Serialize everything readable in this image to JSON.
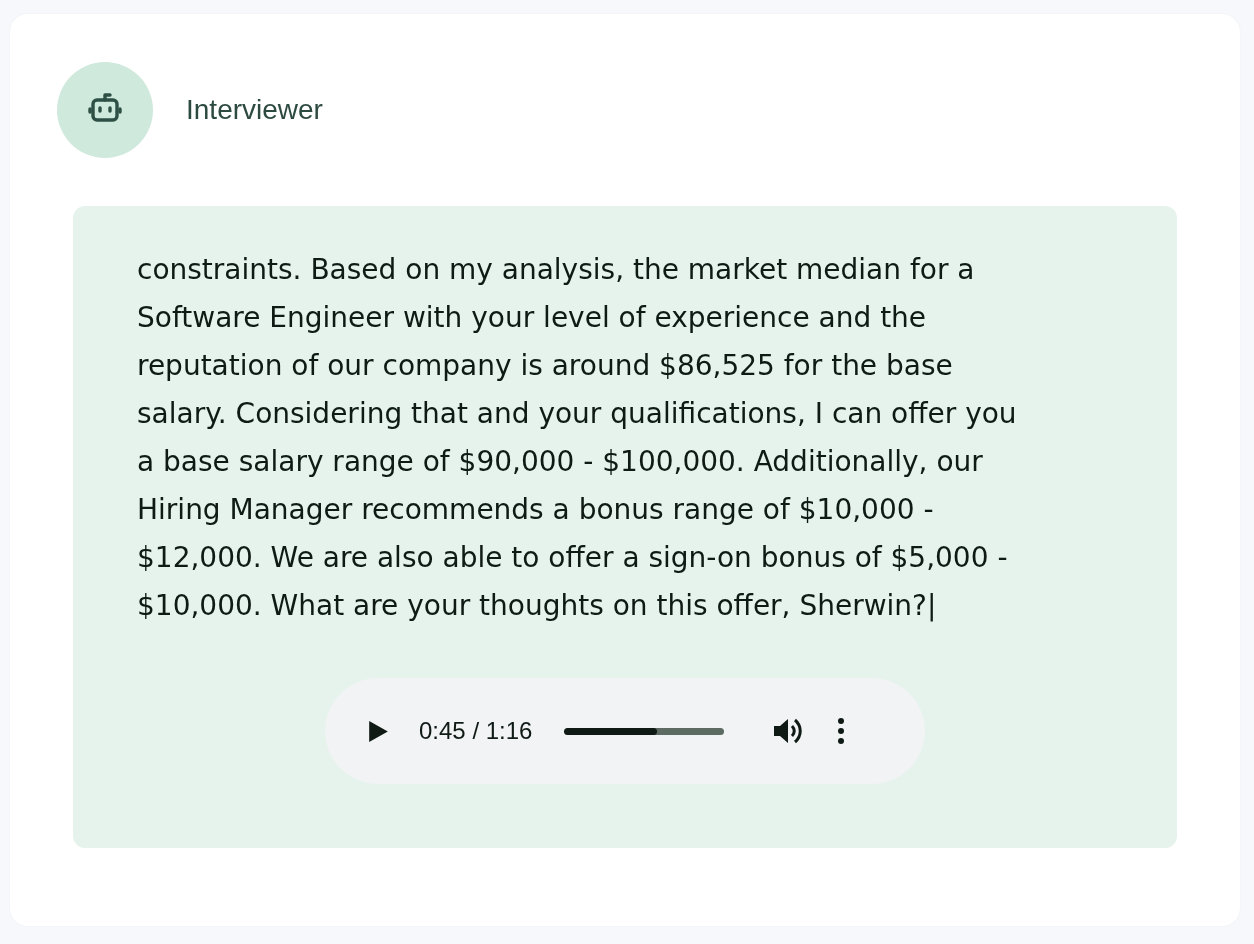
{
  "header": {
    "name": "Interviewer"
  },
  "message": {
    "text": "constraints. Based on my analysis, the market median for a Software Engineer with your level of experience and the reputation of our company is around $86,525 for the base salary. Considering that and your qualifications, I can offer you a base salary range of $90,000 - $100,000. Additionally, our Hiring Manager recommends a bonus range of $10,000 - $12,000. We are also able to offer a sign-on bonus of $5,000 - $10,000. What are your thoughts on this offer, Sherwin?|",
    "audio": {
      "time": "0:45 / 1:16",
      "level": 0.58
    }
  }
}
